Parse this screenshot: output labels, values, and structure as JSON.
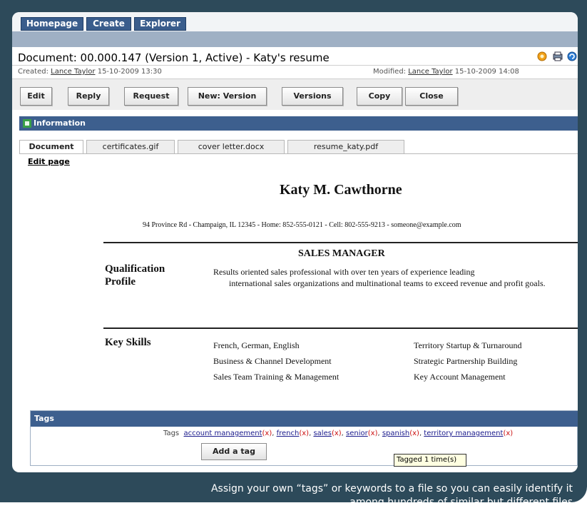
{
  "nav": {
    "tabs": [
      "Homepage",
      "Create",
      "Explorer"
    ]
  },
  "document": {
    "title": "Document: 00.000.147 (Version 1, Active) - Katy's resume",
    "created_label": "Created:",
    "created_by": "Lance Taylor",
    "created_at": "15-10-2009 13:30",
    "modified_label": "Modified:",
    "modified_by": "Lance Taylor",
    "modified_at": "15-10-2009 14:08"
  },
  "toolbar": {
    "buttons": [
      "Edit",
      "Reply",
      "Request",
      "New: Version",
      "Versions",
      "Copy",
      "Close"
    ]
  },
  "info_bar": {
    "label": "Information"
  },
  "file_tabs": [
    "Document",
    "certificates.gif",
    "cover letter.docx",
    "resume_katy.pdf"
  ],
  "edit_page_label": "Edit page",
  "resume": {
    "name": "Katy M. Cawthorne",
    "contact": "94 Province Rd - Champaign, IL 12345 - Home: 852-555-0121 - Cell: 802-555-9213 - someone@example.com",
    "heading": "SALES MANAGER",
    "qualification_label_1": "Qualification",
    "qualification_label_2": "Profile",
    "summary_line_1": "Results oriented sales professional with over ten years of experience leading",
    "summary_line_2": "international sales organizations and multinational teams to exceed revenue and profit goals.",
    "skills_label": "Key Skills",
    "skills_left": [
      "French, German, English",
      "Business & Channel Development",
      "Sales Team Training & Management"
    ],
    "skills_right": [
      "Territory Startup & Turnaround",
      "Strategic Partnership Building",
      "Key Account Management"
    ]
  },
  "tags": {
    "header": "Tags",
    "label": "Tags",
    "items": [
      "account management",
      "french",
      "sales",
      "senior",
      "spanish",
      "territory management"
    ],
    "remove_marker": "(x)",
    "add_button": "Add a tag",
    "tooltip": "Tagged 1 time(s)"
  },
  "caption": {
    "line_1": "Assign your own “tags” or keywords to a file so you can easily identify it",
    "line_2": "among hundreds of similar but different files"
  },
  "colors": {
    "frame": "#2d4a5a",
    "nav_tab": "#3a5d8c",
    "header_bar": "#3d5f8e",
    "tag_link": "#1a1a8c",
    "tag_remove": "#cc1111"
  }
}
